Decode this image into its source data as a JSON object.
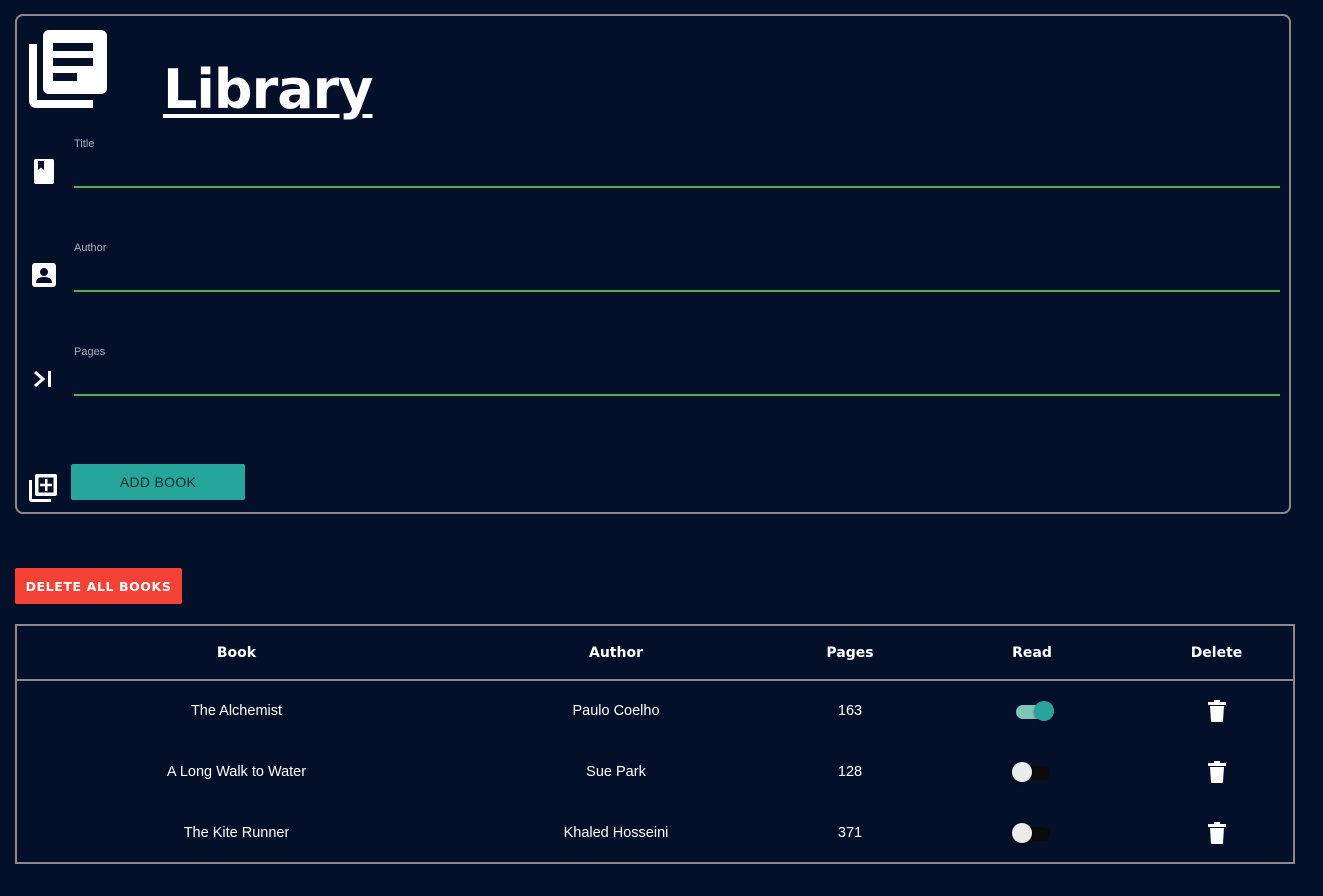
{
  "header": {
    "title": "Library"
  },
  "form": {
    "fields": [
      {
        "label": "Title",
        "value": "",
        "icon": "book-bookmark-icon"
      },
      {
        "label": "Author",
        "value": "",
        "icon": "contact-card-icon"
      },
      {
        "label": "Pages",
        "value": "",
        "icon": "skip-next-icon"
      }
    ],
    "add_button_label": "ADD BOOK"
  },
  "delete_all_label": "DELETE ALL BOOKS",
  "table": {
    "columns": [
      "Book",
      "Author",
      "Pages",
      "Read",
      "Delete"
    ],
    "rows": [
      {
        "book": "The Alchemist",
        "author": "Paulo Coelho",
        "pages": "163",
        "read": true
      },
      {
        "book": "A Long Walk to Water",
        "author": "Sue Park",
        "pages": "128",
        "read": false
      },
      {
        "book": "The Kite Runner",
        "author": "Khaled Hosseini",
        "pages": "371",
        "read": false
      }
    ]
  },
  "colors": {
    "background": "#040f29",
    "accent": "#26a69a",
    "danger": "#f44336",
    "input_underline": "#4caf50",
    "border": "#8a8a8a"
  }
}
